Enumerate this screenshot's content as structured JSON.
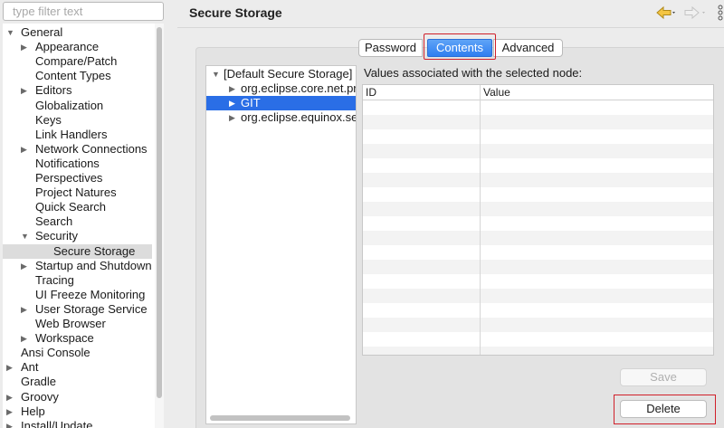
{
  "filter": {
    "placeholder": "type filter text"
  },
  "tree": [
    {
      "label": "General",
      "indent": 0,
      "twisty": "open"
    },
    {
      "label": "Appearance",
      "indent": 1,
      "twisty": "closed"
    },
    {
      "label": "Compare/Patch",
      "indent": 1,
      "twisty": "none"
    },
    {
      "label": "Content Types",
      "indent": 1,
      "twisty": "none"
    },
    {
      "label": "Editors",
      "indent": 1,
      "twisty": "closed"
    },
    {
      "label": "Globalization",
      "indent": 1,
      "twisty": "none"
    },
    {
      "label": "Keys",
      "indent": 1,
      "twisty": "none"
    },
    {
      "label": "Link Handlers",
      "indent": 1,
      "twisty": "none"
    },
    {
      "label": "Network Connections",
      "indent": 1,
      "twisty": "closed"
    },
    {
      "label": "Notifications",
      "indent": 1,
      "twisty": "none"
    },
    {
      "label": "Perspectives",
      "indent": 1,
      "twisty": "none"
    },
    {
      "label": "Project Natures",
      "indent": 1,
      "twisty": "none"
    },
    {
      "label": "Quick Search",
      "indent": 1,
      "twisty": "none"
    },
    {
      "label": "Search",
      "indent": 1,
      "twisty": "none"
    },
    {
      "label": "Security",
      "indent": 1,
      "twisty": "open"
    },
    {
      "label": "Secure Storage",
      "indent": 2,
      "twisty": "none",
      "selected": true
    },
    {
      "label": "Startup and Shutdown",
      "indent": 1,
      "twisty": "closed"
    },
    {
      "label": "Tracing",
      "indent": 1,
      "twisty": "none"
    },
    {
      "label": "UI Freeze Monitoring",
      "indent": 1,
      "twisty": "none"
    },
    {
      "label": "User Storage Service",
      "indent": 1,
      "twisty": "closed"
    },
    {
      "label": "Web Browser",
      "indent": 1,
      "twisty": "none"
    },
    {
      "label": "Workspace",
      "indent": 1,
      "twisty": "closed"
    },
    {
      "label": "Ansi Console",
      "indent": 0,
      "twisty": "none"
    },
    {
      "label": "Ant",
      "indent": 0,
      "twisty": "closed"
    },
    {
      "label": "Gradle",
      "indent": 0,
      "twisty": "none"
    },
    {
      "label": "Groovy",
      "indent": 0,
      "twisty": "closed"
    },
    {
      "label": "Help",
      "indent": 0,
      "twisty": "closed"
    },
    {
      "label": "Install/Update",
      "indent": 0,
      "twisty": "closed"
    }
  ],
  "page": {
    "title": "Secure Storage"
  },
  "icons": {
    "back": "back-arrow-icon",
    "forward": "forward-arrow-icon",
    "menu": "view-menu-icon"
  },
  "tabs": [
    {
      "label": "Password",
      "active": false
    },
    {
      "label": "Contents",
      "active": true
    },
    {
      "label": "Advanced",
      "active": false
    }
  ],
  "nodes": [
    {
      "label": "[Default Secure Storage]",
      "indent": 0,
      "twisty": "open"
    },
    {
      "label": "org.eclipse.core.net.pro",
      "indent": 1,
      "twisty": "closed"
    },
    {
      "label": "GIT",
      "indent": 1,
      "twisty": "closed",
      "selected": true
    },
    {
      "label": "org.eclipse.equinox.sec",
      "indent": 1,
      "twisty": "closed"
    }
  ],
  "values": {
    "label": "Values associated with the selected node:",
    "columns": [
      "ID",
      "Value"
    ]
  },
  "buttons": {
    "save": "Save",
    "delete": "Delete"
  },
  "colors": {
    "accent": "#2a6ee6",
    "highlight": "#d0202a"
  }
}
